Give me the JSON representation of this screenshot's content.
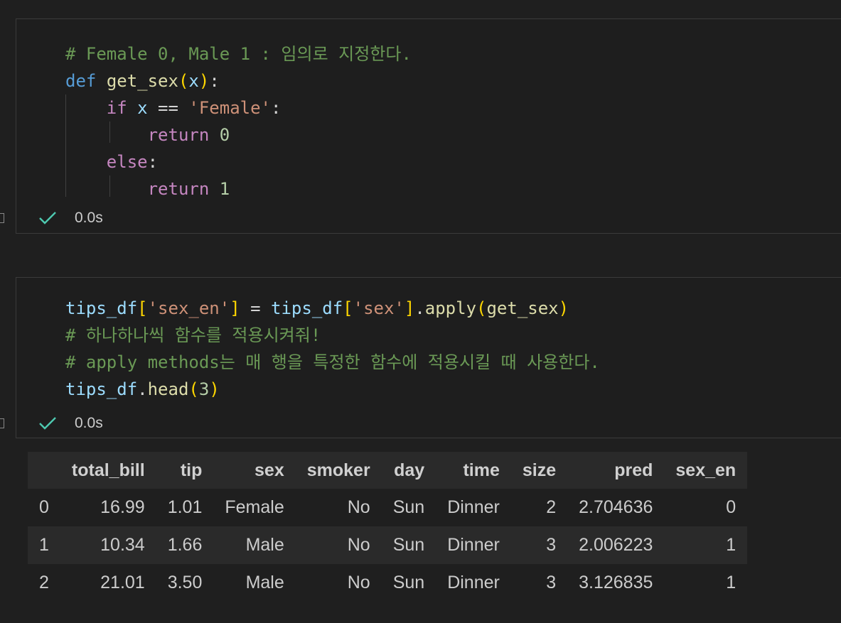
{
  "cells": [
    {
      "lines": [
        [
          {
            "t": "# Female 0, Male 1 : 임의로 지정한다.",
            "c": "comment"
          }
        ],
        [
          {
            "t": "def",
            "c": "kw"
          },
          {
            "t": " ",
            "c": "op"
          },
          {
            "t": "get_sex",
            "c": "fn"
          },
          {
            "t": "(",
            "c": "p1"
          },
          {
            "t": "x",
            "c": "var"
          },
          {
            "t": ")",
            "c": "p1"
          },
          {
            "t": ":",
            "c": "op"
          }
        ],
        [
          {
            "t": "    ",
            "c": "op"
          },
          {
            "t": "if",
            "c": "ctl"
          },
          {
            "t": " ",
            "c": "op"
          },
          {
            "t": "x",
            "c": "var"
          },
          {
            "t": " == ",
            "c": "op"
          },
          {
            "t": "'Female'",
            "c": "str"
          },
          {
            "t": ":",
            "c": "op"
          }
        ],
        [
          {
            "t": "        ",
            "c": "op"
          },
          {
            "t": "return",
            "c": "ctl"
          },
          {
            "t": " ",
            "c": "op"
          },
          {
            "t": "0",
            "c": "num"
          }
        ],
        [
          {
            "t": "    ",
            "c": "op"
          },
          {
            "t": "else",
            "c": "ctl"
          },
          {
            "t": ":",
            "c": "op"
          }
        ],
        [
          {
            "t": "        ",
            "c": "op"
          },
          {
            "t": "return",
            "c": "ctl"
          },
          {
            "t": " ",
            "c": "op"
          },
          {
            "t": "1",
            "c": "num"
          }
        ]
      ],
      "status": "0.0s"
    },
    {
      "lines": [
        [
          {
            "t": "tips_df",
            "c": "var"
          },
          {
            "t": "[",
            "c": "p1"
          },
          {
            "t": "'sex_en'",
            "c": "str"
          },
          {
            "t": "]",
            "c": "p1"
          },
          {
            "t": " = ",
            "c": "op"
          },
          {
            "t": "tips_df",
            "c": "var"
          },
          {
            "t": "[",
            "c": "p1"
          },
          {
            "t": "'sex'",
            "c": "str"
          },
          {
            "t": "]",
            "c": "p1"
          },
          {
            "t": ".",
            "c": "op"
          },
          {
            "t": "apply",
            "c": "fn"
          },
          {
            "t": "(",
            "c": "p1"
          },
          {
            "t": "get_sex",
            "c": "fn"
          },
          {
            "t": ")",
            "c": "p1"
          }
        ],
        [
          {
            "t": "# 하나하나씩 함수를 적용시켜줘!",
            "c": "comment"
          }
        ],
        [
          {
            "t": "# apply methods는 매 행을 특정한 함수에 적용시킬 때 사용한다.",
            "c": "comment"
          }
        ],
        [
          {
            "t": "tips_df",
            "c": "var"
          },
          {
            "t": ".",
            "c": "op"
          },
          {
            "t": "head",
            "c": "fn"
          },
          {
            "t": "(",
            "c": "p1"
          },
          {
            "t": "3",
            "c": "num"
          },
          {
            "t": ")",
            "c": "p1"
          }
        ]
      ],
      "status": "0.0s"
    }
  ],
  "syntax_colors": {
    "comment": "#6a9955",
    "kw": "#569cd6",
    "ctl": "#c586c0",
    "fn": "#dcdcaa",
    "var": "#9cdcfe",
    "str": "#ce9178",
    "num": "#b5cea8",
    "p1": "#ffd700",
    "op": "#d4d4d4"
  },
  "icons": {
    "status": "check-icon"
  },
  "table": {
    "columns": [
      "",
      "total_bill",
      "tip",
      "sex",
      "smoker",
      "day",
      "time",
      "size",
      "pred",
      "sex_en"
    ],
    "rows": [
      [
        "0",
        "16.99",
        "1.01",
        "Female",
        "No",
        "Sun",
        "Dinner",
        "2",
        "2.704636",
        "0"
      ],
      [
        "1",
        "10.34",
        "1.66",
        "Male",
        "No",
        "Sun",
        "Dinner",
        "3",
        "2.006223",
        "1"
      ],
      [
        "2",
        "21.01",
        "3.50",
        "Male",
        "No",
        "Sun",
        "Dinner",
        "3",
        "3.126835",
        "1"
      ]
    ]
  }
}
